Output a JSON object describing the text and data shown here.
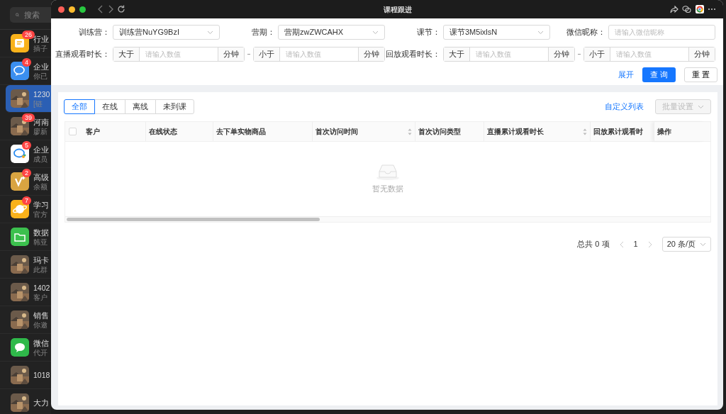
{
  "sidebar": {
    "search": {
      "placeholder": "搜索"
    },
    "chats": [
      {
        "title": "行业",
        "subtitle": "插子",
        "badge": "26",
        "kind": "doc",
        "selected": false
      },
      {
        "title": "企业",
        "subtitle": "你已",
        "badge": "4",
        "kind": "chat",
        "selected": false
      },
      {
        "title": "1230",
        "subtitle": "[链",
        "selected": true
      },
      {
        "title": "河南",
        "subtitle": "廖新",
        "badge": "39",
        "selected": false
      },
      {
        "title": "企业",
        "subtitle": "成员",
        "badge": "5",
        "kind": "color-chat",
        "selected": false
      },
      {
        "title": "高级",
        "subtitle": "余额",
        "badge": "2",
        "kind": "star",
        "selected": false
      },
      {
        "title": "学习",
        "subtitle": "官方",
        "badge": "7",
        "kind": "planet",
        "selected": false
      },
      {
        "title": "数据",
        "subtitle": "韩亚",
        "kind": "folder",
        "selected": false
      },
      {
        "title": "玛卡",
        "subtitle": "此群",
        "selected": false
      },
      {
        "title": "1402",
        "subtitle": "客户",
        "selected": false
      },
      {
        "title": "销售",
        "subtitle": "你邀",
        "selected": false
      },
      {
        "title": "微信",
        "subtitle": "代开",
        "kind": "bubble",
        "selected": false
      },
      {
        "title": "1018",
        "selected": false
      },
      {
        "title": "大力",
        "selected": false
      }
    ]
  },
  "window": {
    "title": "课程跟进"
  },
  "filters": {
    "selects": [
      {
        "label": "训练营：",
        "value": "训练营NuYG9BzI"
      },
      {
        "label": "营期：",
        "value": "营期zwZWCAHX"
      },
      {
        "label": "课节：",
        "value": "课节3M5ixlsN"
      }
    ],
    "nickname": {
      "label": "微信昵称：",
      "placeholder": "请输入微信昵称"
    },
    "ranges": [
      {
        "label": "直播观看时长：",
        "from": {
          "prefix": "大于",
          "placeholder": "请输入数值",
          "suffix": "分钟"
        },
        "to": {
          "prefix": "小于",
          "placeholder": "请输入数值",
          "suffix": "分钟"
        }
      },
      {
        "label": "回放观看时长：",
        "from": {
          "prefix": "大于",
          "placeholder": "请输入数值",
          "suffix": "分钟"
        },
        "to": {
          "prefix": "小于",
          "placeholder": "请输入数值",
          "suffix": "分钟"
        }
      }
    ],
    "expand": "展开",
    "query": "查 询",
    "reset": "重 置"
  },
  "tabs": [
    {
      "label": "全部",
      "selected": true
    },
    {
      "label": "在线",
      "selected": false
    },
    {
      "label": "离线",
      "selected": false
    },
    {
      "label": "未到课",
      "selected": false
    }
  ],
  "custom_columns": "自定义列表",
  "batch_button": {
    "label": "批量设置",
    "disabled": true
  },
  "table": {
    "select_all": {
      "checked": false
    },
    "columns": [
      {
        "label": "客户",
        "sortable": false
      },
      {
        "label": "在线状态",
        "sortable": false
      },
      {
        "label": "去下单实物商品",
        "sortable": false
      },
      {
        "label": "首次访问时间",
        "sortable": true
      },
      {
        "label": "首次访问类型",
        "sortable": false
      },
      {
        "label": "直播累计观看时长",
        "sortable": true
      },
      {
        "label": "回放累计观看时",
        "sortable": false
      },
      {
        "label": "操作",
        "sortable": false
      }
    ],
    "empty": "暂无数据"
  },
  "pagination": {
    "total": "总共 0 项",
    "page": "1",
    "page_size": "20 条/页"
  }
}
